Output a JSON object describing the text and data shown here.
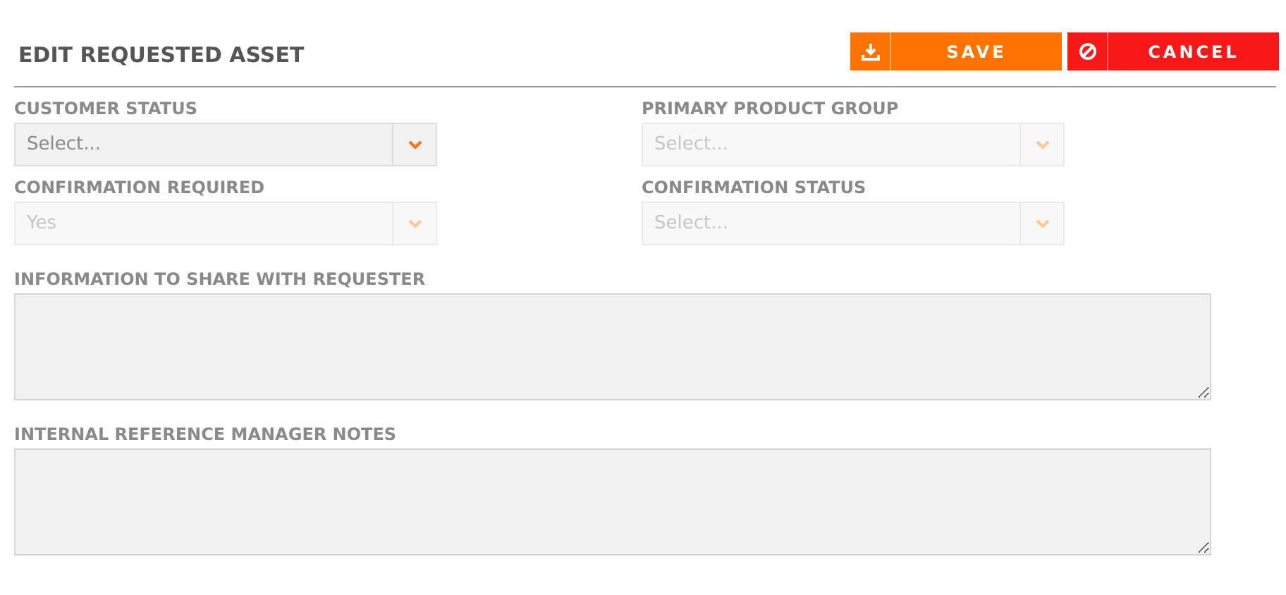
{
  "title": "EDIT REQUESTED ASSET",
  "buttons": [
    {
      "kind": "save",
      "label": "SAVE"
    },
    {
      "kind": "cancel",
      "label": "CANCEL"
    }
  ],
  "selects": [
    {
      "label": "CUSTOMER STATUS",
      "placeholder": "Select...",
      "disabled": false
    },
    {
      "label": "PRIMARY PRODUCT GROUP",
      "placeholder": "Select...",
      "disabled": true
    },
    {
      "label": "CONFIRMATION REQUIRED",
      "value": "Yes",
      "disabled": true
    },
    {
      "label": "CONFIRMATION STATUS",
      "placeholder": "Select...",
      "disabled": true
    }
  ],
  "textareas": [
    {
      "label": "INFORMATION TO SHARE WITH REQUESTER"
    },
    {
      "label": "INTERNAL REFERENCE MANAGER NOTES"
    }
  ]
}
